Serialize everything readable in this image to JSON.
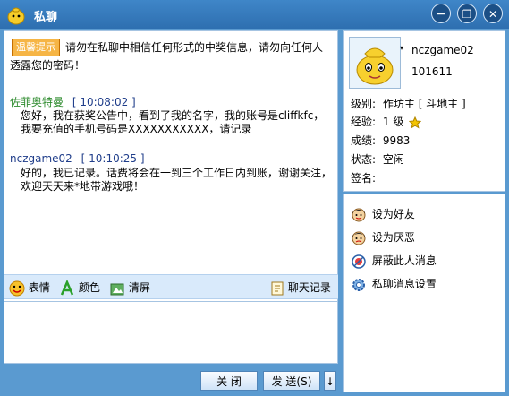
{
  "window": {
    "title": "私聊",
    "controls": {
      "minimize": "−",
      "restore": "❐",
      "close": "✕"
    }
  },
  "chat": {
    "tip": {
      "tag": "温馨提示",
      "text": "请勿在私聊中相信任何形式的中奖信息，请勿向任何人透露您的密码！"
    },
    "messages": [
      {
        "sender": "佐菲奥特曼",
        "time": "[ 10:08:02 ]",
        "body": "您好，我在获奖公告中，看到了我的名字，我的账号是cliffkfc，我要充值的手机号码是XXXXXXXXXXX，请记录"
      },
      {
        "sender": "nczgame02",
        "time": "[ 10:10:25 ]",
        "body": "好的，我已记录。话费将会在一到三个工作日内到账，谢谢关注，欢迎天天来*地带游戏哦！"
      }
    ]
  },
  "toolbar": {
    "emoji": "表情",
    "color": "颜色",
    "clear": "清屏",
    "history": "聊天记录"
  },
  "footer": {
    "close_label": "关 闭",
    "send_label": "发 送(S)",
    "dropdown": "↓"
  },
  "profile": {
    "name": "nczgame02",
    "id": "101611",
    "level_label": "级别:",
    "level_value": "作坊主 [ 斗地主 ]",
    "exp_label": "经验:",
    "exp_value": "1 级",
    "score_label": "成绩:",
    "score_value": "9983",
    "status_label": "状态:",
    "status_value": "空闲",
    "signature_label": "签名:"
  },
  "actions": [
    {
      "label": "设为好友"
    },
    {
      "label": "设为厌恶"
    },
    {
      "label": "屏蔽此人消息"
    },
    {
      "label": "私聊消息设置"
    }
  ],
  "colors": {
    "title_bar": "#2e6fb0",
    "sender_green": "#2e8b2e",
    "sender_blue": "#1f3d8a",
    "tip_orange": "#f6b545"
  }
}
